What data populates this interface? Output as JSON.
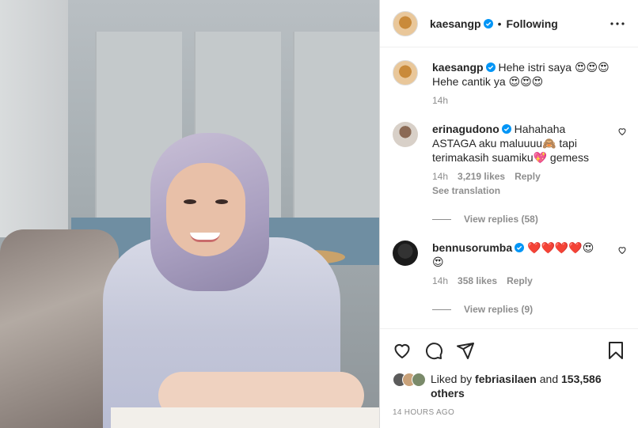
{
  "post": {
    "username": "kaesangp",
    "follow_status": "Following",
    "caption_line1": "Hehe istri saya 😍😍😍",
    "caption_line2": "Hehe cantik ya 😍😍😍",
    "caption_time": "14h"
  },
  "comments": [
    {
      "username": "erinagudono",
      "text_line1": "Hahahaha",
      "text_line2": "ASTAGA aku maluuuu🙈 tapi",
      "text_line3": "terimakasih suamiku💖 gemess",
      "time": "14h",
      "likes": "3,219 likes",
      "reply": "Reply",
      "see_translation": "See translation",
      "view_replies": "View replies (58)"
    },
    {
      "username": "bennusorumba",
      "text_line1": "❤️❤️❤️❤️😍",
      "text_line2": "😍",
      "time": "14h",
      "likes": "358 likes",
      "reply": "Reply",
      "view_replies": "View replies (9)"
    }
  ],
  "liked_by": {
    "prefix": "Liked by",
    "user": "febriasilaen",
    "and": "and",
    "count": "153,586",
    "suffix": "others"
  },
  "time_ago": "14 HOURS AGO",
  "colors": {
    "verified": "#0095f6",
    "heart": "#ed4956",
    "muted": "#8e8e8e"
  },
  "icons": [
    "heart-icon",
    "comment-icon",
    "share-icon",
    "bookmark-icon",
    "more-icon",
    "verified-icon"
  ]
}
